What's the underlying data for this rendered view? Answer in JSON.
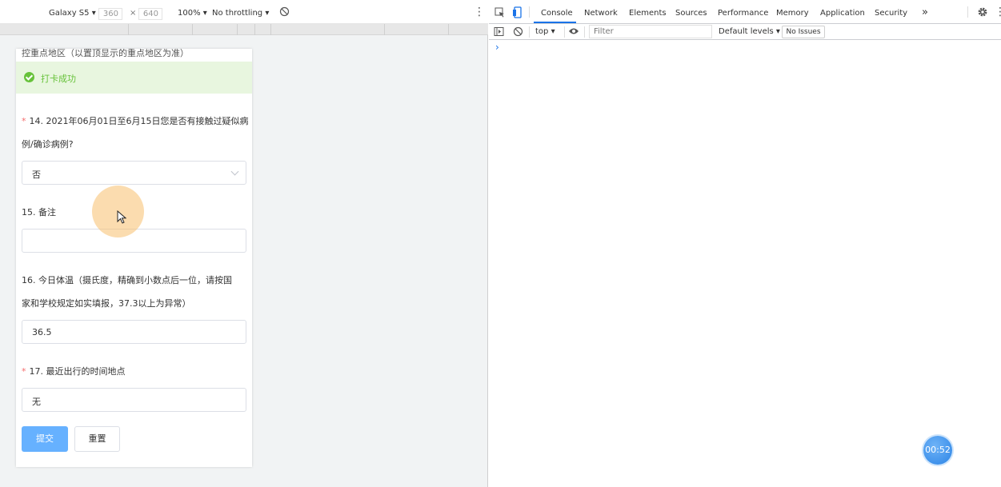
{
  "device_toolbar": {
    "device": "Galaxy S5",
    "width": "360",
    "height": "640",
    "times": "×",
    "zoom": "100%",
    "throttling": "No throttling"
  },
  "form": {
    "top_partial": "控重点地区（以置顶显示的重点地区为准）",
    "success": "打卡成功",
    "q14_line1": "14. 2021年06月01日至6月15日您是否有接触过疑似病",
    "q14_line2": "例/确诊病例?",
    "q14_value": "否",
    "q15_label": "15. 备注",
    "q15_value": "",
    "q16_line1": "16. 今日体温（摄氏度，精确到小数点后一位，请按国",
    "q16_line2": "家和学校规定如实填报，37.3以上为异常）",
    "q16_value": "36.5",
    "q17_label": "17. 最近出行的时间地点",
    "q17_value": "无",
    "required_mark": "*",
    "submit": "提交",
    "reset": "重置"
  },
  "devtools": {
    "tabs": [
      "Console",
      "Network",
      "Elements",
      "Sources",
      "Performance",
      "Memory",
      "Application",
      "Security"
    ],
    "more": "»",
    "context": "top",
    "filter_placeholder": "Filter",
    "levels": "Default levels",
    "issues": "No Issues",
    "prompt": "›"
  },
  "timer": "00:52",
  "colors": {
    "success_green": "#67c23a",
    "submit_blue": "#66b1ff",
    "devtools_accent": "#1a73e8"
  }
}
